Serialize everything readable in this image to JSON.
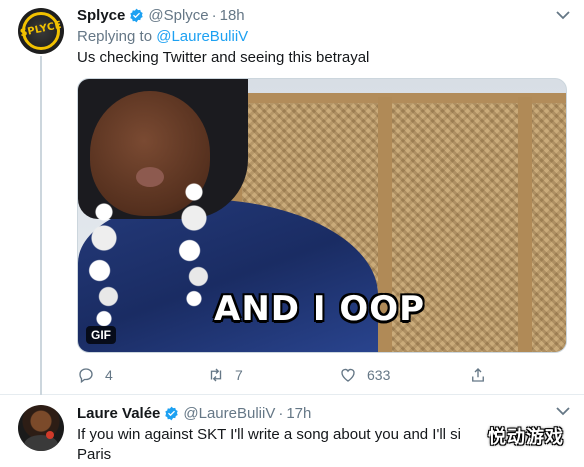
{
  "tweets": [
    {
      "name": "Splyce",
      "handle": "@Splyce",
      "separator": "·",
      "time": "18h",
      "replying_prefix": "Replying to",
      "replying_to": "@LaureBuliiV",
      "text": "Us checking Twitter and seeing this betrayal",
      "media": {
        "caption": "AND I OOP",
        "badge": "GIF"
      },
      "avatar_text": "SPLYCE",
      "actions": {
        "replies": "4",
        "retweets": "7",
        "likes": "633"
      }
    },
    {
      "name": "Laure Valée",
      "handle": "@LaureBuliiV",
      "separator": "·",
      "time": "17h",
      "text": "If you win against SKT I'll write a song about you and I'll si",
      "text_line2": "Paris"
    }
  ],
  "watermark": "悦动游戏",
  "colors": {
    "accent": "#1da1f2",
    "muted": "#657786",
    "brand_splyce": "#f2c100"
  },
  "icons": [
    "verified-badge-icon",
    "chevron-down-icon",
    "reply-icon",
    "retweet-icon",
    "like-icon",
    "share-icon"
  ]
}
